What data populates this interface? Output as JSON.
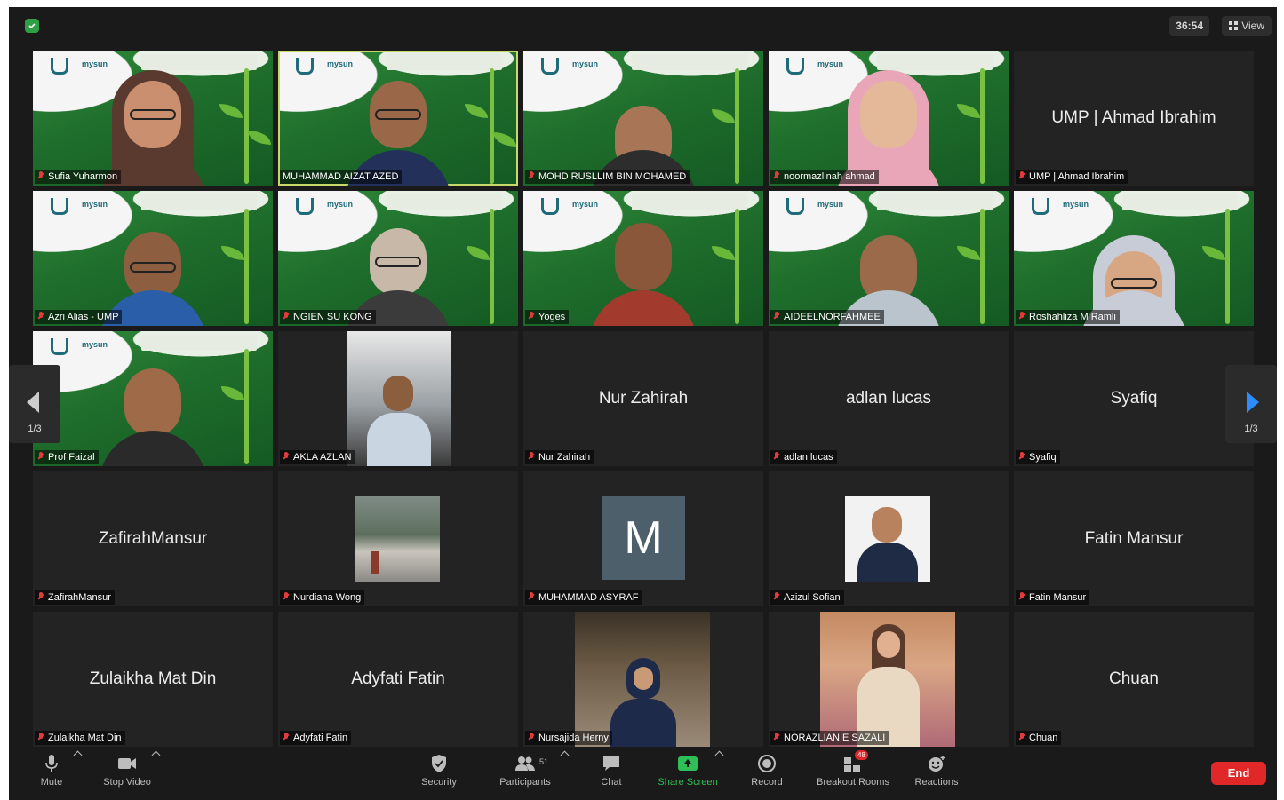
{
  "topbar": {
    "timer": "36:54",
    "view_label": "View"
  },
  "tiles": [
    {
      "name": "Sufia Yuharmon"
    },
    {
      "name": "MUHAMMAD AIZAT AZED"
    },
    {
      "name": "MOHD RUSLLIM BIN MOHAMED"
    },
    {
      "name": "noormazlinah ahmad"
    },
    {
      "name": "UMP | Ahmad Ibrahim",
      "display": "UMP | Ahmad Ibrahim"
    },
    {
      "name": "Azri Alias - UMP"
    },
    {
      "name": "NGIEN SU KONG"
    },
    {
      "name": "Yoges"
    },
    {
      "name": "AIDEELNORFAHMEE"
    },
    {
      "name": "Roshahliza M Ramli"
    },
    {
      "name": "Prof Faizal"
    },
    {
      "name": "AKLA AZLAN"
    },
    {
      "name": "Nur Zahirah",
      "display": "Nur Zahirah"
    },
    {
      "name": "adlan lucas",
      "display": "adlan lucas"
    },
    {
      "name": "Syafiq",
      "display": "Syafiq"
    },
    {
      "name": "ZafirahMansur",
      "display": "ZafirahMansur"
    },
    {
      "name": "Nurdiana Wong"
    },
    {
      "name": "MUHAMMAD ASYRAF",
      "avatar": "M"
    },
    {
      "name": "Azizul Sofian"
    },
    {
      "name": "Fatin Mansur",
      "display": "Fatin Mansur"
    },
    {
      "name": "Zulaikha Mat Din",
      "display": "Zulaikha Mat Din"
    },
    {
      "name": "Adyfati Fatin",
      "display": "Adyfati Fatin"
    },
    {
      "name": "Nursajida Herny"
    },
    {
      "name": "NORAZLIANIE SAZALI"
    },
    {
      "name": "Chuan",
      "display": "Chuan"
    }
  ],
  "pager": {
    "left": "1/3",
    "right": "1/3"
  },
  "toolbar": {
    "mute": "Mute",
    "stop_video": "Stop Video",
    "security": "Security",
    "participants": "Participants",
    "participants_count": "51",
    "chat": "Chat",
    "share_screen": "Share Screen",
    "record": "Record",
    "breakout_rooms": "Breakout Rooms",
    "breakout_badge": "48",
    "reactions": "Reactions",
    "end": "End"
  },
  "colors": {
    "accent_green": "#2fbf56",
    "end_red": "#e02828",
    "share_green": "#2fbf56",
    "active_border": "#c9d86a"
  }
}
